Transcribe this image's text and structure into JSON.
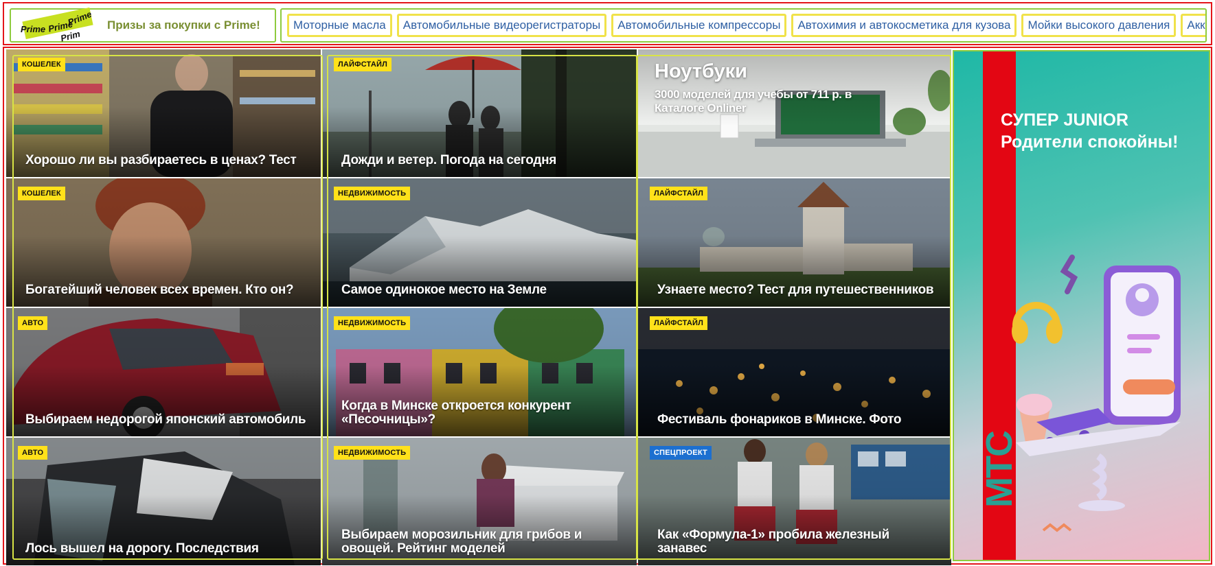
{
  "prime": {
    "logo_words": [
      "Prime",
      "Prime",
      "Prime",
      "Prim"
    ],
    "link_label": "Призы за покупки с Prime!"
  },
  "categories": [
    "Моторные масла",
    "Автомобильные видеорегистраторы",
    "Автомобильные компрессоры",
    "Автохимия и автокосметика для кузова",
    "Мойки высокого давления",
    "Аккумуляторы"
  ],
  "tiles": [
    {
      "badge": "КОШЕЛЕК",
      "title": "Хорошо ли вы разбираетесь в ценах? Тест",
      "scene": "supermarket"
    },
    {
      "badge": "ЛАЙФСТАЙЛ",
      "title": "Дожди и ветер. Погода на сегодня",
      "scene": "rain"
    },
    {
      "badge": "",
      "title": "",
      "promo_title": "Ноутбуки",
      "promo_sub": "3000 моделей для учебы от 711 р. в Каталоге Onliner",
      "scene": "laptop"
    },
    {
      "badge": "КОШЕЛЕК",
      "title": "Богатейший человек всех времен. Кто он?",
      "scene": "portrait"
    },
    {
      "badge": "НЕДВИЖИМОСТЬ",
      "title": "Самое одинокое место на Земле",
      "scene": "glacier"
    },
    {
      "badge": "ЛАЙФСТАЙЛ",
      "title": "Узнаете место? Тест для путешественников",
      "scene": "castle"
    },
    {
      "badge": "АВТО",
      "title": "Выбираем недорогой японский автомобиль",
      "scene": "car"
    },
    {
      "badge": "НЕДВИЖИМОСТЬ",
      "title": "Когда в Минске откроется конкурент «Песочницы»?",
      "scene": "building"
    },
    {
      "badge": "ЛАЙФСТАЙЛ",
      "title": "Фестиваль фонариков в Минске. Фото",
      "scene": "lanterns"
    },
    {
      "badge": "АВТО",
      "title": "Лось вышел на дорогу. Последствия",
      "scene": "crash"
    },
    {
      "badge": "НЕДВИЖИМОСТЬ",
      "title": "Выбираем морозильник для грибов и овощей. Рейтинг моделей",
      "scene": "freezer"
    },
    {
      "badge": "СПЕЦПРОЕКТ",
      "badge_style": "blue",
      "title": "Как «Формула-1» пробила железный занавес",
      "scene": "formula"
    }
  ],
  "ad": {
    "line1": "СУПЕР JUNIOR",
    "line2": "Родители спокойны!",
    "brand": "МТС"
  },
  "colors": {
    "frame_red": "#e3151a",
    "frame_green": "#8ecb3e",
    "frame_yellow": "#d8e445",
    "badge_yellow": "#ffe11a",
    "badge_blue": "#1c6fd0",
    "link_blue": "#2e5fa3"
  }
}
